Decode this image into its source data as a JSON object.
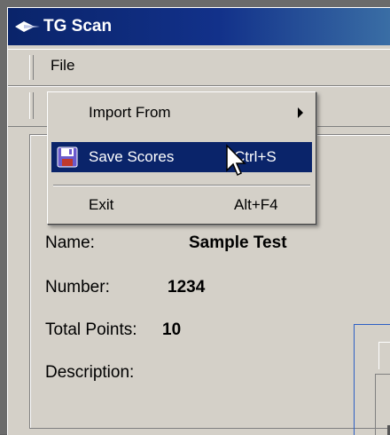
{
  "window": {
    "title": "TG Scan"
  },
  "menubar": {
    "file_label": "File"
  },
  "file_menu": {
    "import_from": {
      "label": "Import From"
    },
    "save_scores": {
      "label": "Save Scores",
      "shortcut": "Ctrl+S"
    },
    "exit": {
      "label": "Exit",
      "shortcut": "Alt+F4"
    }
  },
  "details": {
    "name_label": "Name:",
    "name_value": "Sample Test",
    "number_label": "Number:",
    "number_value": "1234",
    "total_points_label": "Total Points:",
    "total_points_value": "10",
    "description_label": "Description:"
  },
  "colors": {
    "title_bar": "#0a246a",
    "menu_highlight": "#0a246a",
    "window_face": "#d4d0c8"
  },
  "icons": [
    "app-icon",
    "submenu-arrow-icon",
    "save-icon",
    "mouse-cursor-icon"
  ]
}
